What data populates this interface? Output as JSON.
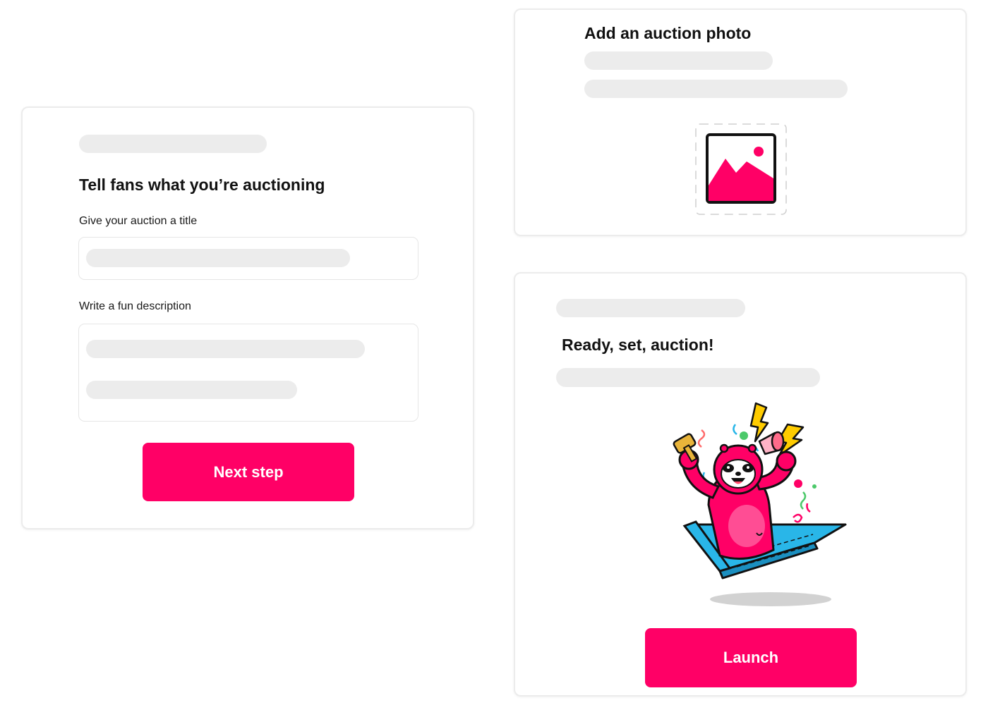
{
  "colors": {
    "accent": "#ff0066",
    "skeleton": "#ececec",
    "card_border": "#ececec",
    "laptop": "#29b6e8",
    "confetti_yellow": "#ffcc00",
    "confetti_green": "#4cc96a"
  },
  "details_card": {
    "heading": "Tell fans what you’re auctioning",
    "title_label": "Give your auction a title",
    "description_label": "Write a fun description",
    "next_button": "Next step"
  },
  "photo_card": {
    "heading": "Add an auction photo",
    "icon": "image-placeholder-icon"
  },
  "launch_card": {
    "heading": "Ready, set, auction!",
    "illustration": "sloth-mascot-celebrating-illustration",
    "launch_button": "Launch"
  }
}
